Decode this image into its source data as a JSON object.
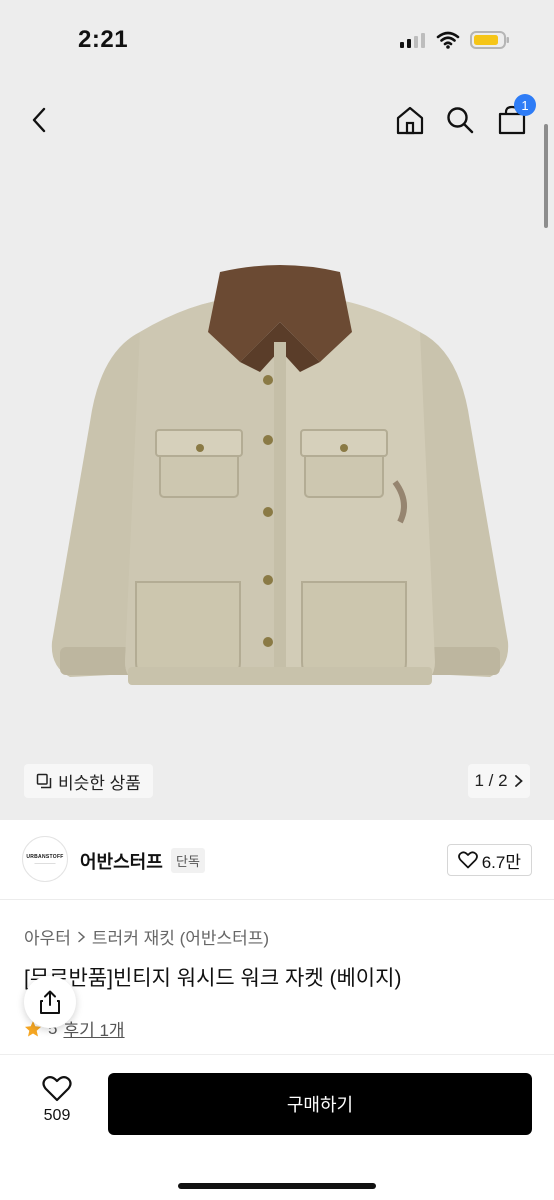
{
  "status_bar": {
    "time": "2:21"
  },
  "nav": {
    "cart_count": "1"
  },
  "gallery": {
    "similar_label": "비슷한 상품",
    "page_counter": "1 / 2"
  },
  "brand": {
    "logo_text": "URBANSTOFF",
    "name": "어반스터프",
    "tag": "단독",
    "likes": "6.7만"
  },
  "product": {
    "breadcrumb": [
      "아우터",
      "트러커 재킷 (어반스터프)"
    ],
    "title": "[무료반품]빈티지 워시드 워크 자켓 (베이지)",
    "rating": "5",
    "review_label": "후기 1개"
  },
  "bottom_bar": {
    "wish_count": "509",
    "buy_label": "구매하기"
  },
  "colors": {
    "badge": "#2e7cf6",
    "buy_button": "#000000",
    "rating_star": "#f5a623"
  }
}
